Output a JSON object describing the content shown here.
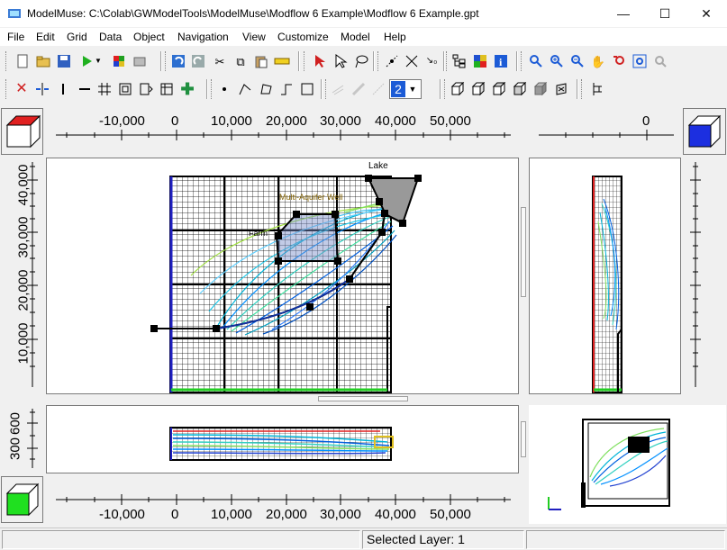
{
  "window": {
    "title": "ModelMuse: C:\\Colab\\GWModelTools\\ModelMuse\\Modflow 6 Example\\Modflow 6 Example.gpt",
    "minimize": "—",
    "maximize": "☐",
    "close": "✕"
  },
  "menu": [
    "File",
    "Edit",
    "Grid",
    "Data",
    "Object",
    "Navigation",
    "View",
    "Customize",
    "Model",
    "Help"
  ],
  "toolbar": {
    "layer_value": "2"
  },
  "top_view": {
    "ruler_labels": [
      "-10,000",
      "0",
      "10,000",
      "20,000",
      "30,000",
      "40,000",
      "50,000"
    ],
    "y_ruler_labels": [
      "40,000",
      "30,000",
      "20,000",
      "10,000"
    ],
    "label_lake": "Lake",
    "label_multi_aquifer": "Multi-Aquifer Well",
    "label_farm": "Farm"
  },
  "side_view": {
    "ruler_label": "0"
  },
  "front_view": {
    "ruler_labels": [
      "-10,000",
      "0",
      "10,000",
      "20,000",
      "30,000",
      "40,000",
      "50,000"
    ],
    "z_ruler_labels": [
      "600",
      "300"
    ]
  },
  "status": {
    "selected_layer": "Selected Layer: 1"
  },
  "colors": {
    "accent_blue": "#1c5bd6",
    "grid_black": "#000000",
    "river_red": "#e02020",
    "boundary_green": "#22cc22",
    "boundary_blue": "#2020c0"
  }
}
